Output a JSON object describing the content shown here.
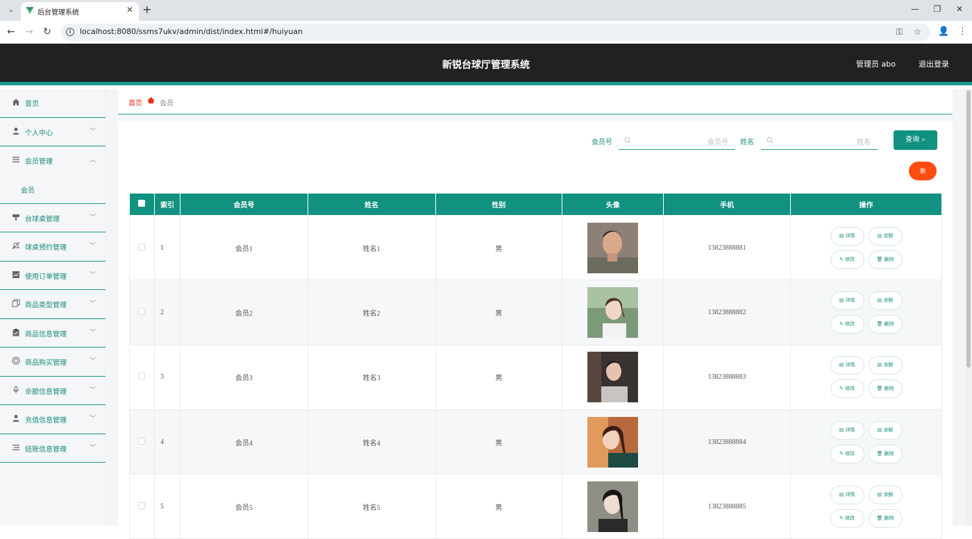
{
  "browser": {
    "tab_title": "后台管理系统",
    "url": "localhost:8080/ssms7ukv/admin/dist/index.html#/huiyuan"
  },
  "header": {
    "title": "新锐台球厅管理系统",
    "admin_label": "管理员 abo",
    "logout_label": "退出登录"
  },
  "sidebar": {
    "items": [
      {
        "label": "首页",
        "icon": "home-icon"
      },
      {
        "label": "个人中心",
        "icon": "user-icon"
      },
      {
        "label": "会员管理",
        "icon": "menu-icon",
        "expanded": true,
        "children": [
          {
            "label": "会员"
          }
        ]
      },
      {
        "label": "台球桌管理",
        "icon": "table-icon"
      },
      {
        "label": "球桌预约管理",
        "icon": "bell-off-icon"
      },
      {
        "label": "使用订单管理",
        "icon": "chart-icon"
      },
      {
        "label": "商品类型管理",
        "icon": "copy-icon"
      },
      {
        "label": "商品信息管理",
        "icon": "clipboard-icon"
      },
      {
        "label": "商品购买管理",
        "icon": "target-icon"
      },
      {
        "label": "余额信息管理",
        "icon": "microphone-icon"
      },
      {
        "label": "充值信息管理",
        "icon": "user-icon"
      },
      {
        "label": "结账信息管理",
        "icon": "list-icon"
      }
    ]
  },
  "breadcrumb": {
    "home": "首页",
    "current": "会员"
  },
  "search": {
    "member_label": "会员号",
    "member_placeholder": "会员号",
    "name_label": "姓名",
    "name_placeholder": "姓名",
    "query_label": "查询"
  },
  "delete_button_label": "删",
  "table": {
    "headers": [
      "索引",
      "会员号",
      "姓名",
      "性别",
      "头像",
      "手机",
      "操作"
    ],
    "rows": [
      {
        "index": "1",
        "member_no": "会员1",
        "name": "姓名1",
        "gender": "男",
        "phone": "13823888881"
      },
      {
        "index": "2",
        "member_no": "会员2",
        "name": "姓名2",
        "gender": "男",
        "phone": "13823888882"
      },
      {
        "index": "3",
        "member_no": "会员3",
        "name": "姓名3",
        "gender": "男",
        "phone": "13823888883"
      },
      {
        "index": "4",
        "member_no": "会员4",
        "name": "姓名4",
        "gender": "男",
        "phone": "13823888884"
      },
      {
        "index": "5",
        "member_no": "会员5",
        "name": "姓名5",
        "gender": "男",
        "phone": "13823888885"
      }
    ],
    "actions": {
      "detail": "详情",
      "balance": "余额",
      "edit": "修改",
      "delete": "删除"
    }
  },
  "colors": {
    "accent": "#11917f",
    "header_bg": "#212121",
    "danger": "#ff4d11",
    "breadcrumb_home": "#e5331d"
  }
}
